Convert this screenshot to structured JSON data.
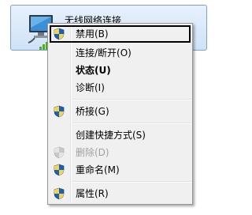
{
  "connection": {
    "name": "无线网络连接",
    "icon": "wireless-network-connection-icon"
  },
  "menu": {
    "items": [
      {
        "label": "禁用(B)",
        "icon": "uac-shield-icon",
        "highlighted": true,
        "bold": false,
        "disabled": false
      },
      {
        "label": "连接/断开(O)",
        "icon": "",
        "highlighted": false,
        "bold": false,
        "disabled": false
      },
      {
        "label": "状态(U)",
        "icon": "",
        "highlighted": false,
        "bold": true,
        "disabled": false
      },
      {
        "label": "诊断(I)",
        "icon": "",
        "highlighted": false,
        "bold": false,
        "disabled": false
      },
      {
        "label": "桥接(G)",
        "icon": "uac-shield-icon",
        "highlighted": false,
        "bold": false,
        "disabled": false
      },
      {
        "label": "创建快捷方式(S)",
        "icon": "",
        "highlighted": false,
        "bold": false,
        "disabled": false
      },
      {
        "label": "删除(D)",
        "icon": "uac-shield-icon",
        "highlighted": false,
        "bold": false,
        "disabled": true
      },
      {
        "label": "重命名(M)",
        "icon": "uac-shield-icon",
        "highlighted": false,
        "bold": false,
        "disabled": false
      },
      {
        "label": "属性(R)",
        "icon": "uac-shield-icon",
        "highlighted": false,
        "bold": false,
        "disabled": false
      }
    ]
  },
  "colors": {
    "selection_border": "#7da2ce",
    "menu_background": "#f0f0f0",
    "disabled_text": "#a0a0a0",
    "focus_border": "#000000"
  }
}
